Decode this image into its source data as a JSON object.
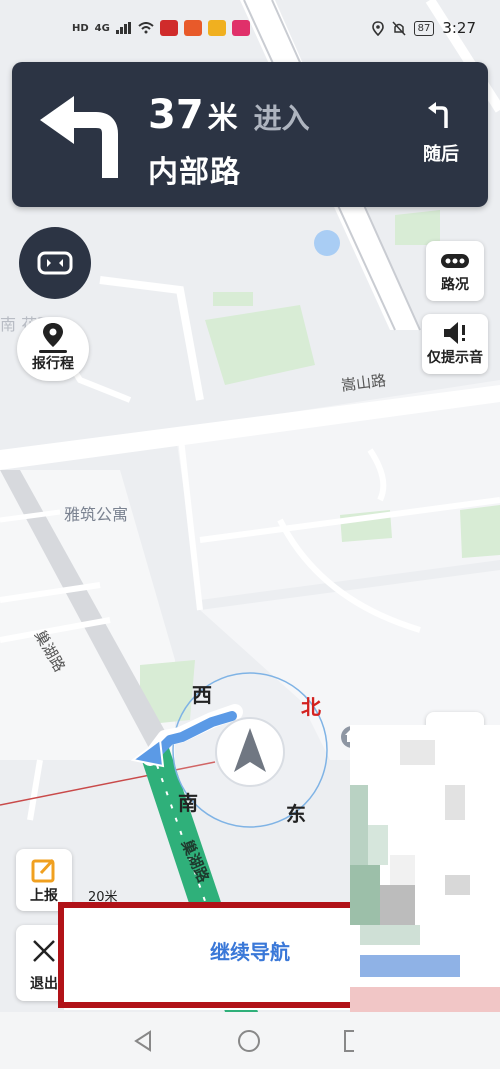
{
  "status_bar": {
    "left_icons": [
      "HD",
      "4G"
    ],
    "battery": "87",
    "time": "3:27"
  },
  "guidance": {
    "distance_value": "37",
    "distance_unit": "米",
    "action": "进入",
    "road_name": "内部路",
    "then_label": "随后",
    "turn_icon": "turn-left-arrow-icon",
    "then_icon": "turn-left-small-icon"
  },
  "left_controls": {
    "report_trip_label": "报行程"
  },
  "right_controls": {
    "traffic_label": "路况",
    "voice_only_label": "仅提示音"
  },
  "map": {
    "labels": {
      "area_partial": "南  花园",
      "road_songshan": "嵩山路",
      "poi_yazhu": "雅筑公寓",
      "road_chaohu_1": "巢湖路",
      "road_chaohu_2": "巢湖路"
    },
    "compass": {
      "west": "西",
      "north": "北",
      "south": "南",
      "east": "东"
    },
    "scale": "20米",
    "route_color": "#2fb07a",
    "north_color": "#d3211f"
  },
  "bottom_controls": {
    "report_label": "上报",
    "exit_label": "退出",
    "continue_label": "继续导航"
  },
  "colors": {
    "nav_card": "#2c3444",
    "accent_blue": "#3a78d8",
    "highlight_red": "#b11218"
  }
}
